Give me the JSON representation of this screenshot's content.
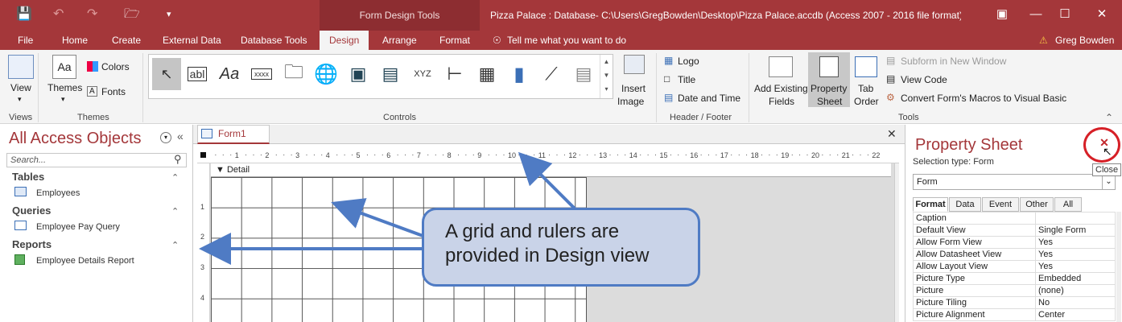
{
  "titlebar": {
    "context_label": "Form Design Tools",
    "title": "Pizza Palace : Database- C:\\Users\\GregBowden\\Desktop\\Pizza Palace.accdb (Access 2007 - 2016 file format) -...",
    "user": "Greg Bowden"
  },
  "tabs": [
    "File",
    "Home",
    "Create",
    "External Data",
    "Database Tools",
    "Design",
    "Arrange",
    "Format"
  ],
  "tell_me": "Tell me what you want to do",
  "ribbon": {
    "views": {
      "btn": "View",
      "group": "Views"
    },
    "themes": {
      "btn": "Themes",
      "colors": "Colors",
      "fonts": "Fonts",
      "group": "Themes"
    },
    "controls": {
      "group": "Controls",
      "textbox": "abl",
      "label": "Aa",
      "xxxx": "xxxx",
      "xyz": "XYZ"
    },
    "insert_image": {
      "line1": "Insert",
      "line2": "Image"
    },
    "header_footer": {
      "logo": "Logo",
      "title": "Title",
      "datetime": "Date and Time",
      "group": "Header / Footer"
    },
    "tools": {
      "add_fields_1": "Add Existing",
      "add_fields_2": "Fields",
      "prop_1": "Property",
      "prop_2": "Sheet",
      "tab_1": "Tab",
      "tab_2": "Order",
      "subform": "Subform in New Window",
      "view_code": "View Code",
      "convert": "Convert Form's Macros to Visual Basic",
      "group": "Tools"
    }
  },
  "nav": {
    "title": "All Access Objects",
    "search_placeholder": "Search...",
    "sections": [
      {
        "name": "Tables",
        "item": "Employees"
      },
      {
        "name": "Queries",
        "item": "Employee Pay Query"
      },
      {
        "name": "Reports",
        "item": "Employee Details Report"
      }
    ]
  },
  "design": {
    "tab": "Form1",
    "section": "Detail",
    "ruler_labels": [
      "1",
      "2",
      "3",
      "4",
      "5",
      "6",
      "7",
      "8",
      "9",
      "10",
      "11",
      "12",
      "13",
      "14",
      "15",
      "16",
      "17",
      "18",
      "19",
      "20",
      "21",
      "22"
    ],
    "vruler_labels": [
      "1",
      "2",
      "3",
      "4"
    ]
  },
  "callout": {
    "text": "A grid and rulers are provided in Design view"
  },
  "props": {
    "title": "Property Sheet",
    "selection_label": "Selection type:  Form",
    "selected": "Form",
    "tabs": [
      "Format",
      "Data",
      "Event",
      "Other",
      "All"
    ],
    "rows": [
      [
        "Caption",
        ""
      ],
      [
        "Default View",
        "Single Form"
      ],
      [
        "Allow Form View",
        "Yes"
      ],
      [
        "Allow Datasheet View",
        "Yes"
      ],
      [
        "Allow Layout View",
        "Yes"
      ],
      [
        "Picture Type",
        "Embedded"
      ],
      [
        "Picture",
        "(none)"
      ],
      [
        "Picture Tiling",
        "No"
      ],
      [
        "Picture Alignment",
        "Center"
      ]
    ],
    "close_tip": "Close"
  },
  "colors": {
    "accent": "#a4373a",
    "callout_fill": "#c9d3e8",
    "callout_border": "#4f7bc4",
    "highlight": "#d62027"
  }
}
